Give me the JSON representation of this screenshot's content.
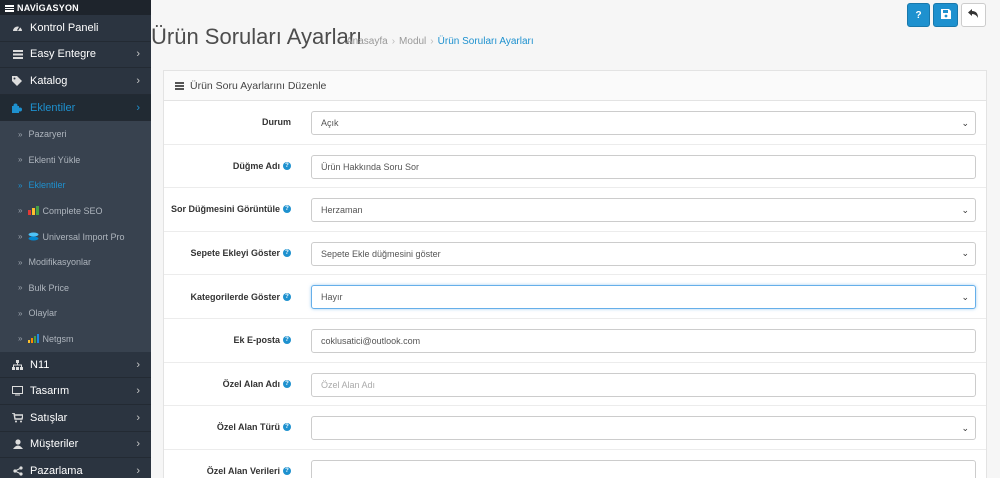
{
  "sidebar": {
    "heading": "NAVİGASYON",
    "items": [
      {
        "label": "Kontrol Paneli",
        "icon": "dashboard-icon"
      },
      {
        "label": "Easy Entegre",
        "icon": "list-icon"
      },
      {
        "label": "Katalog",
        "icon": "tag-icon"
      },
      {
        "label": "Eklentiler",
        "icon": "puzzle-icon"
      },
      {
        "label": "N11",
        "icon": "sitemap-icon"
      },
      {
        "label": "Tasarım",
        "icon": "monitor-icon"
      },
      {
        "label": "Satışlar",
        "icon": "cart-icon"
      },
      {
        "label": "Müşteriler",
        "icon": "user-icon"
      },
      {
        "label": "Pazarlama",
        "icon": "share-icon"
      }
    ],
    "sub_items": [
      {
        "label": "Pazaryeri"
      },
      {
        "label": "Eklenti Yükle"
      },
      {
        "label": "Eklentiler"
      },
      {
        "label": "Complete SEO"
      },
      {
        "label": "Universal Import Pro"
      },
      {
        "label": "Modifikasyonlar"
      },
      {
        "label": "Bulk Price"
      },
      {
        "label": "Olaylar"
      },
      {
        "label": "Netgsm"
      }
    ]
  },
  "header": {
    "title": "Ürün Soruları Ayarları",
    "breadcrumb": [
      "Anasayfa",
      "Modul",
      "Ürün Soruları Ayarları"
    ]
  },
  "toolbar": {
    "help_label": "?"
  },
  "panel": {
    "title": "Ürün Soru Ayarlarını Düzenle",
    "fields": [
      {
        "label": "Durum",
        "value": "Açık",
        "type": "select",
        "help": false
      },
      {
        "label": "Düğme Adı",
        "value": "Ürün Hakkında Soru Sor",
        "type": "input",
        "help": true
      },
      {
        "label": "Sor Düğmesini Görüntüle",
        "value": "Herzaman",
        "type": "select",
        "help": true
      },
      {
        "label": "Sepete Ekleyi Göster",
        "value": "Sepete Ekle düğmesini göster",
        "type": "select",
        "help": true
      },
      {
        "label": "Kategorilerde Göster",
        "value": "Hayır",
        "type": "select",
        "help": true
      },
      {
        "label": "Ek E-posta",
        "value": "coklusatici@outlook.com",
        "type": "input",
        "help": true
      },
      {
        "label": "Özel Alan Adı",
        "placeholder": "Özel Alan Adı",
        "type": "input",
        "help": true
      },
      {
        "label": "Özel Alan Türü",
        "value": "",
        "type": "select",
        "help": true
      },
      {
        "label": "Özel Alan Verileri",
        "value": "",
        "type": "input",
        "help": true
      }
    ]
  },
  "colors": {
    "accent": "#1e91cf",
    "sidebar": "#2b3440",
    "submenu": "#38424f"
  }
}
